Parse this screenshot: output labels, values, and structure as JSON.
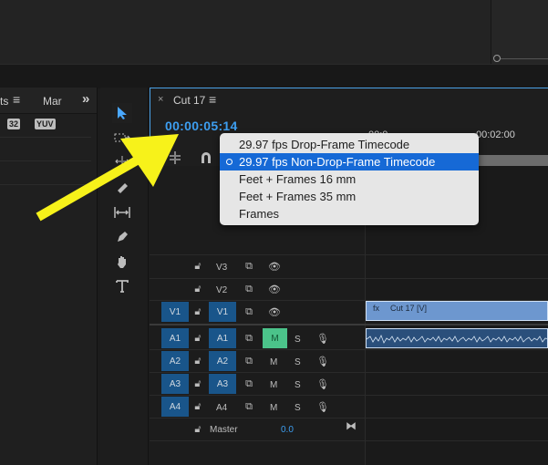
{
  "project_panel": {
    "tab_partial": "ts",
    "tab_markers": "Mar",
    "badge_32": "32",
    "badge_yuv": "YUV"
  },
  "timeline": {
    "tab_title": "Cut 17",
    "timecode": "00:00:05:14",
    "ruler_time": "00:02:00",
    "ruler_time_partial": "00:0",
    "tracks": [
      {
        "source": "",
        "name": "V3"
      },
      {
        "source": "",
        "name": "V2"
      },
      {
        "source": "V1",
        "name": "V1"
      },
      {
        "source": "A1",
        "name": "A1"
      },
      {
        "source": "A2",
        "name": "A2"
      },
      {
        "source": "A3",
        "name": "A3"
      },
      {
        "source": "A4",
        "name": "A4"
      }
    ],
    "master_label": "Master",
    "master_value": "0.0",
    "mute_label": "M",
    "solo_label": "S",
    "clip_v1_label": "Cut 17 [V]"
  },
  "timecode_menu": {
    "items": [
      "29.97 fps Drop-Frame Timecode",
      "29.97 fps Non-Drop-Frame Timecode",
      "Feet + Frames 16 mm",
      "Feet + Frames 35 mm",
      "Frames"
    ],
    "selected_index": 1
  },
  "colors": {
    "accent_blue": "#3d9ef0",
    "track_blue": "#19558a",
    "menu_highlight": "#1669d6",
    "arrow_yellow": "#f7f21a",
    "mute_green": "#4bc38a"
  }
}
